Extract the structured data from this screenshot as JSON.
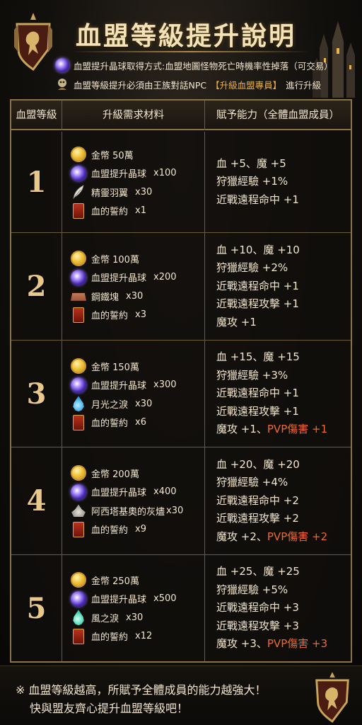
{
  "header": {
    "title": "血盟等級提升說明",
    "note1_text": "血盟提升晶球取得方式:血盟地圖怪物死亡時機率性掉落（可交易）",
    "note2_prefix": "血盟等級提升必須由王族對話NPC",
    "note2_highlight": "【升級血盟專員】",
    "note2_suffix": "進行升級",
    "note1_icon": "purple-orb-icon",
    "note2_icon": "npc-skull-icon"
  },
  "table": {
    "headers": [
      "血盟等級",
      "升級需求材料",
      "賦予能力（全體血盟成員）"
    ],
    "rows": [
      {
        "level": "1",
        "materials": [
          {
            "icon": "gold-coin-icon",
            "name": "金幣 50萬",
            "qty": ""
          },
          {
            "icon": "clan-orb-icon",
            "name": "血盟提升晶球",
            "qty": "x100"
          },
          {
            "icon": "feather-icon",
            "name": "精靈羽翼",
            "qty": "x30"
          },
          {
            "icon": "blood-oath-book-icon",
            "name": "血的誓約",
            "qty": "x1"
          }
        ],
        "buffs": [
          {
            "text": "血 +5、魔 +5",
            "pvp": ""
          },
          {
            "text": "狩獵經驗 +1%",
            "pvp": ""
          },
          {
            "text": "近戰遠程命中 +1",
            "pvp": ""
          }
        ]
      },
      {
        "level": "2",
        "materials": [
          {
            "icon": "gold-coin-icon",
            "name": "金幣 100萬",
            "qty": ""
          },
          {
            "icon": "clan-orb-icon",
            "name": "血盟提升晶球",
            "qty": "x200"
          },
          {
            "icon": "steel-ingot-icon",
            "name": "鋼鐵塊",
            "qty": "x30"
          },
          {
            "icon": "blood-oath-book-icon",
            "name": "血的誓約",
            "qty": "x3"
          }
        ],
        "buffs": [
          {
            "text": "血 +10、魔 +10",
            "pvp": ""
          },
          {
            "text": "狩獵經驗 +2%",
            "pvp": ""
          },
          {
            "text": "近戰遠程命中 +1",
            "pvp": ""
          },
          {
            "text": "近戰遠程攻擊 +1",
            "pvp": ""
          },
          {
            "text": "魔攻 +1",
            "pvp": ""
          }
        ]
      },
      {
        "level": "3",
        "materials": [
          {
            "icon": "gold-coin-icon",
            "name": "金幣 150萬",
            "qty": ""
          },
          {
            "icon": "clan-orb-icon",
            "name": "血盟提升晶球",
            "qty": "x300"
          },
          {
            "icon": "moonlight-tear-icon",
            "name": "月光之淚",
            "qty": "x30"
          },
          {
            "icon": "blood-oath-book-icon",
            "name": "血的誓約",
            "qty": "x6"
          }
        ],
        "buffs": [
          {
            "text": "血 +15、魔 +15",
            "pvp": ""
          },
          {
            "text": "狩獵經驗 +3%",
            "pvp": ""
          },
          {
            "text": "近戰遠程命中 +1",
            "pvp": ""
          },
          {
            "text": "近戰遠程攻擊 +1",
            "pvp": ""
          },
          {
            "text": "魔攻 +1、",
            "pvp": "PVP傷害 +1"
          }
        ]
      },
      {
        "level": "4",
        "materials": [
          {
            "icon": "gold-coin-icon",
            "name": "金幣 200萬",
            "qty": ""
          },
          {
            "icon": "clan-orb-icon",
            "name": "血盟提升晶球",
            "qty": "x400"
          },
          {
            "icon": "ash-icon",
            "name": "阿西塔基奧的灰燼",
            "qty": "x30"
          },
          {
            "icon": "blood-oath-book-icon",
            "name": "血的誓約",
            "qty": "x9"
          }
        ],
        "buffs": [
          {
            "text": "血 +20、魔 +20",
            "pvp": ""
          },
          {
            "text": "狩獵經驗 +4%",
            "pvp": ""
          },
          {
            "text": "近戰遠程命中 +2",
            "pvp": ""
          },
          {
            "text": "近戰遠程攻擊 +2",
            "pvp": ""
          },
          {
            "text": "魔攻 +2、",
            "pvp": "PVP傷害 +2"
          }
        ]
      },
      {
        "level": "5",
        "materials": [
          {
            "icon": "gold-coin-icon",
            "name": "金幣 250萬",
            "qty": ""
          },
          {
            "icon": "clan-orb-icon",
            "name": "血盟提升晶球",
            "qty": "x500"
          },
          {
            "icon": "wind-tear-icon",
            "name": "風之淚",
            "qty": "x30"
          },
          {
            "icon": "blood-oath-book-icon",
            "name": "血的誓約",
            "qty": "x12"
          }
        ],
        "buffs": [
          {
            "text": "血 +25、魔 +25",
            "pvp": ""
          },
          {
            "text": "狩獵經驗 +5%",
            "pvp": ""
          },
          {
            "text": "近戰遠程命中 +3",
            "pvp": ""
          },
          {
            "text": "近戰遠程攻擊 +3",
            "pvp": ""
          },
          {
            "text": "魔攻 +3、",
            "pvp": "PVP傷害 +3"
          }
        ]
      }
    ]
  },
  "footer": {
    "line1": "※ 血盟等級越高，所賦予全體成員的能力越強大！",
    "line2": "快與盟友齊心提升血盟等級吧！"
  },
  "colors": {
    "gold_text": "#e9c98a",
    "pvp_orange": "#ee6a2f",
    "highlight_orange": "#f0b040",
    "border_gold": "#8a7248"
  }
}
